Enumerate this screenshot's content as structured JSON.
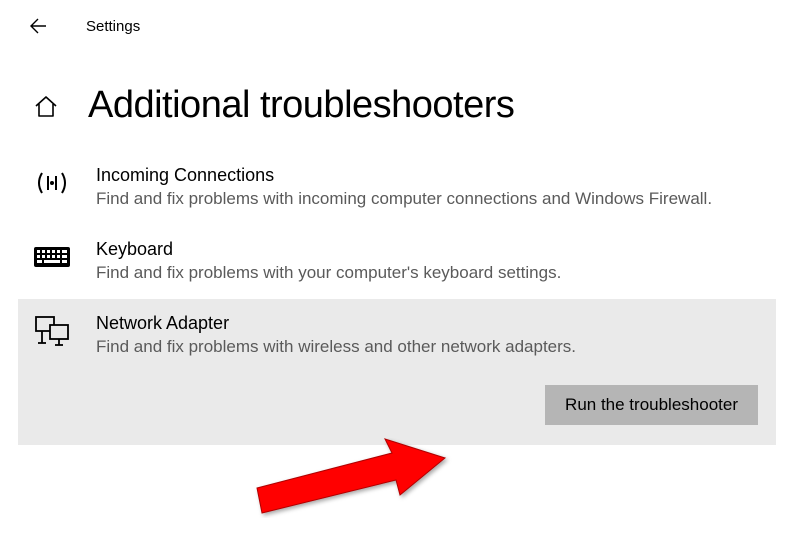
{
  "header": {
    "title": "Settings"
  },
  "page": {
    "title": "Additional troubleshooters"
  },
  "troubleshooters": [
    {
      "title": "Incoming Connections",
      "desc": "Find and fix problems with incoming computer connections and Windows Firewall."
    },
    {
      "title": "Keyboard",
      "desc": "Find and fix problems with your computer's keyboard settings."
    },
    {
      "title": "Network Adapter",
      "desc": "Find and fix problems with wireless and other network adapters."
    }
  ],
  "run_button_label": "Run the troubleshooter"
}
